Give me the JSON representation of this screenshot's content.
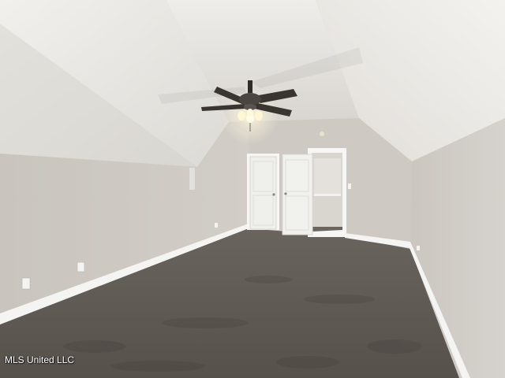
{
  "photo": {
    "watermark": "MLS United LLC",
    "colors": {
      "ceiling": "#e9e8e4",
      "wall": "#cdc8c2",
      "carpet": "#5c5650",
      "baseboard": "#f4f4f2",
      "door": "#f2f2f0",
      "fan_blade": "#3a3530"
    }
  }
}
